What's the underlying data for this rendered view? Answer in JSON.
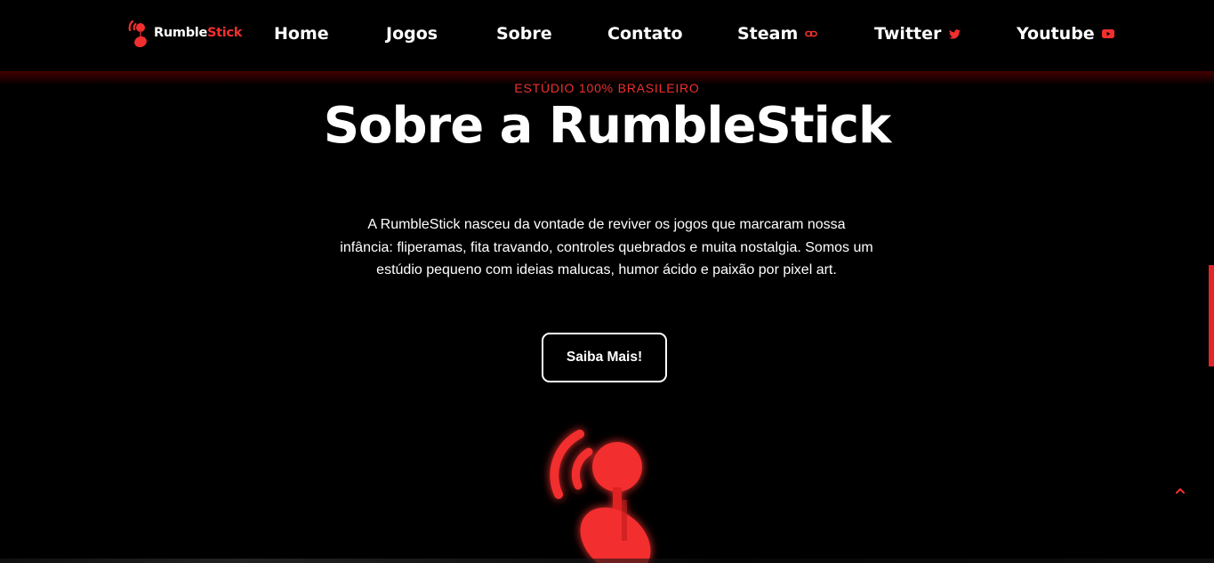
{
  "brand": {
    "name_part1": "Rumble",
    "name_part2": "Stick",
    "accent_color": "#f22f2f"
  },
  "nav": {
    "home": "Home",
    "jogos": "Jogos",
    "sobre": "Sobre",
    "contato": "Contato",
    "steam": {
      "label": "Steam",
      "icon": "link-icon"
    },
    "twitter": {
      "label": "Twitter",
      "icon": "twitter-icon"
    },
    "youtube": {
      "label": "Youtube",
      "icon": "youtube-icon"
    }
  },
  "hero": {
    "eyebrow": "ESTÚDIO 100% BRASILEIRO",
    "title": "Sobre a RumbleStick",
    "description": "A RumbleStick nasceu da vontade de reviver os jogos que marcaram nossa infância: fliperamas, fita travando, controles quebrados e muita nostalgia. Somos um estúdio pequeno com ideias malucas, humor ácido e paixão por pixel art.",
    "cta": "Saiba Mais!",
    "illustration_icon": "joystick-icon"
  },
  "colors": {
    "background": "#000000",
    "text": "#ffffff",
    "accent": "#f22f2f"
  }
}
